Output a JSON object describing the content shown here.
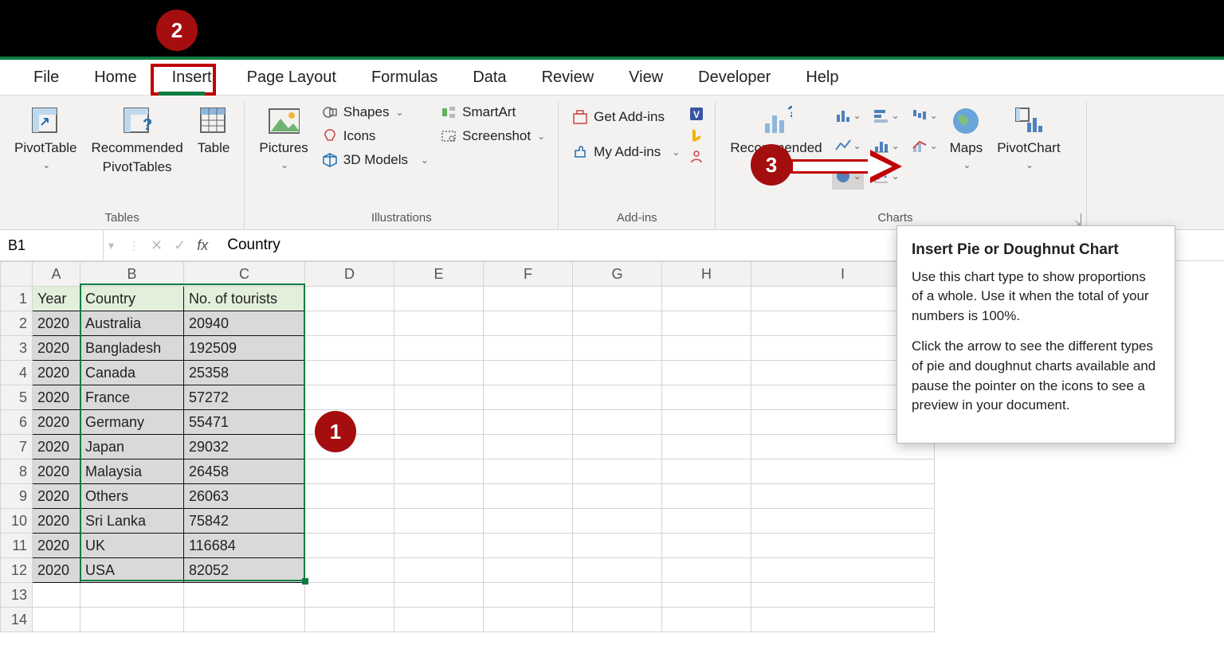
{
  "tabs": [
    "File",
    "Home",
    "Insert",
    "Page Layout",
    "Formulas",
    "Data",
    "Review",
    "View",
    "Developer",
    "Help"
  ],
  "active_tab": "Insert",
  "ribbon": {
    "tables": {
      "label": "Tables",
      "pivot": "PivotTable",
      "recpivot_l1": "Recommended",
      "recpivot_l2": "PivotTables",
      "table": "Table"
    },
    "illus": {
      "label": "Illustrations",
      "pictures": "Pictures",
      "shapes": "Shapes",
      "icons": "Icons",
      "models": "3D Models",
      "smartart": "SmartArt",
      "screenshot": "Screenshot"
    },
    "addins": {
      "label": "Add-ins",
      "get": "Get Add-ins",
      "my": "My Add-ins"
    },
    "charts": {
      "label": "Charts",
      "rec_l1": "Recommended",
      "rec_l2": "Charts",
      "maps": "Maps",
      "pivotchart": "PivotChart"
    }
  },
  "tooltip": {
    "title": "Insert Pie or Doughnut Chart",
    "p1": "Use this chart type to show proportions of a whole. Use it when the total of your numbers is 100%.",
    "p2": "Click the arrow to see the different types of pie and doughnut charts available and pause the pointer on the icons to see a preview in your document."
  },
  "formula": {
    "namebox": "B1",
    "fx": "Country"
  },
  "columns": [
    "A",
    "B",
    "C",
    "D",
    "E",
    "F",
    "G",
    "H",
    "I"
  ],
  "headers": {
    "A": "Year",
    "B": "Country",
    "C": "No. of tourists"
  },
  "data_rows": [
    {
      "A": "2020",
      "B": "Australia",
      "C": "20940"
    },
    {
      "A": "2020",
      "B": "Bangladesh",
      "C": "192509"
    },
    {
      "A": "2020",
      "B": "Canada",
      "C": "25358"
    },
    {
      "A": "2020",
      "B": "France",
      "C": "57272"
    },
    {
      "A": "2020",
      "B": "Germany",
      "C": "55471"
    },
    {
      "A": "2020",
      "B": "Japan",
      "C": "29032"
    },
    {
      "A": "2020",
      "B": "Malaysia",
      "C": "26458"
    },
    {
      "A": "2020",
      "B": "Others",
      "C": "26063"
    },
    {
      "A": "2020",
      "B": "Sri Lanka",
      "C": "75842"
    },
    {
      "A": "2020",
      "B": "UK",
      "C": "116684"
    },
    {
      "A": "2020",
      "B": "USA",
      "C": "82052"
    }
  ],
  "callouts": {
    "c1": "1",
    "c2": "2",
    "c3": "3"
  }
}
